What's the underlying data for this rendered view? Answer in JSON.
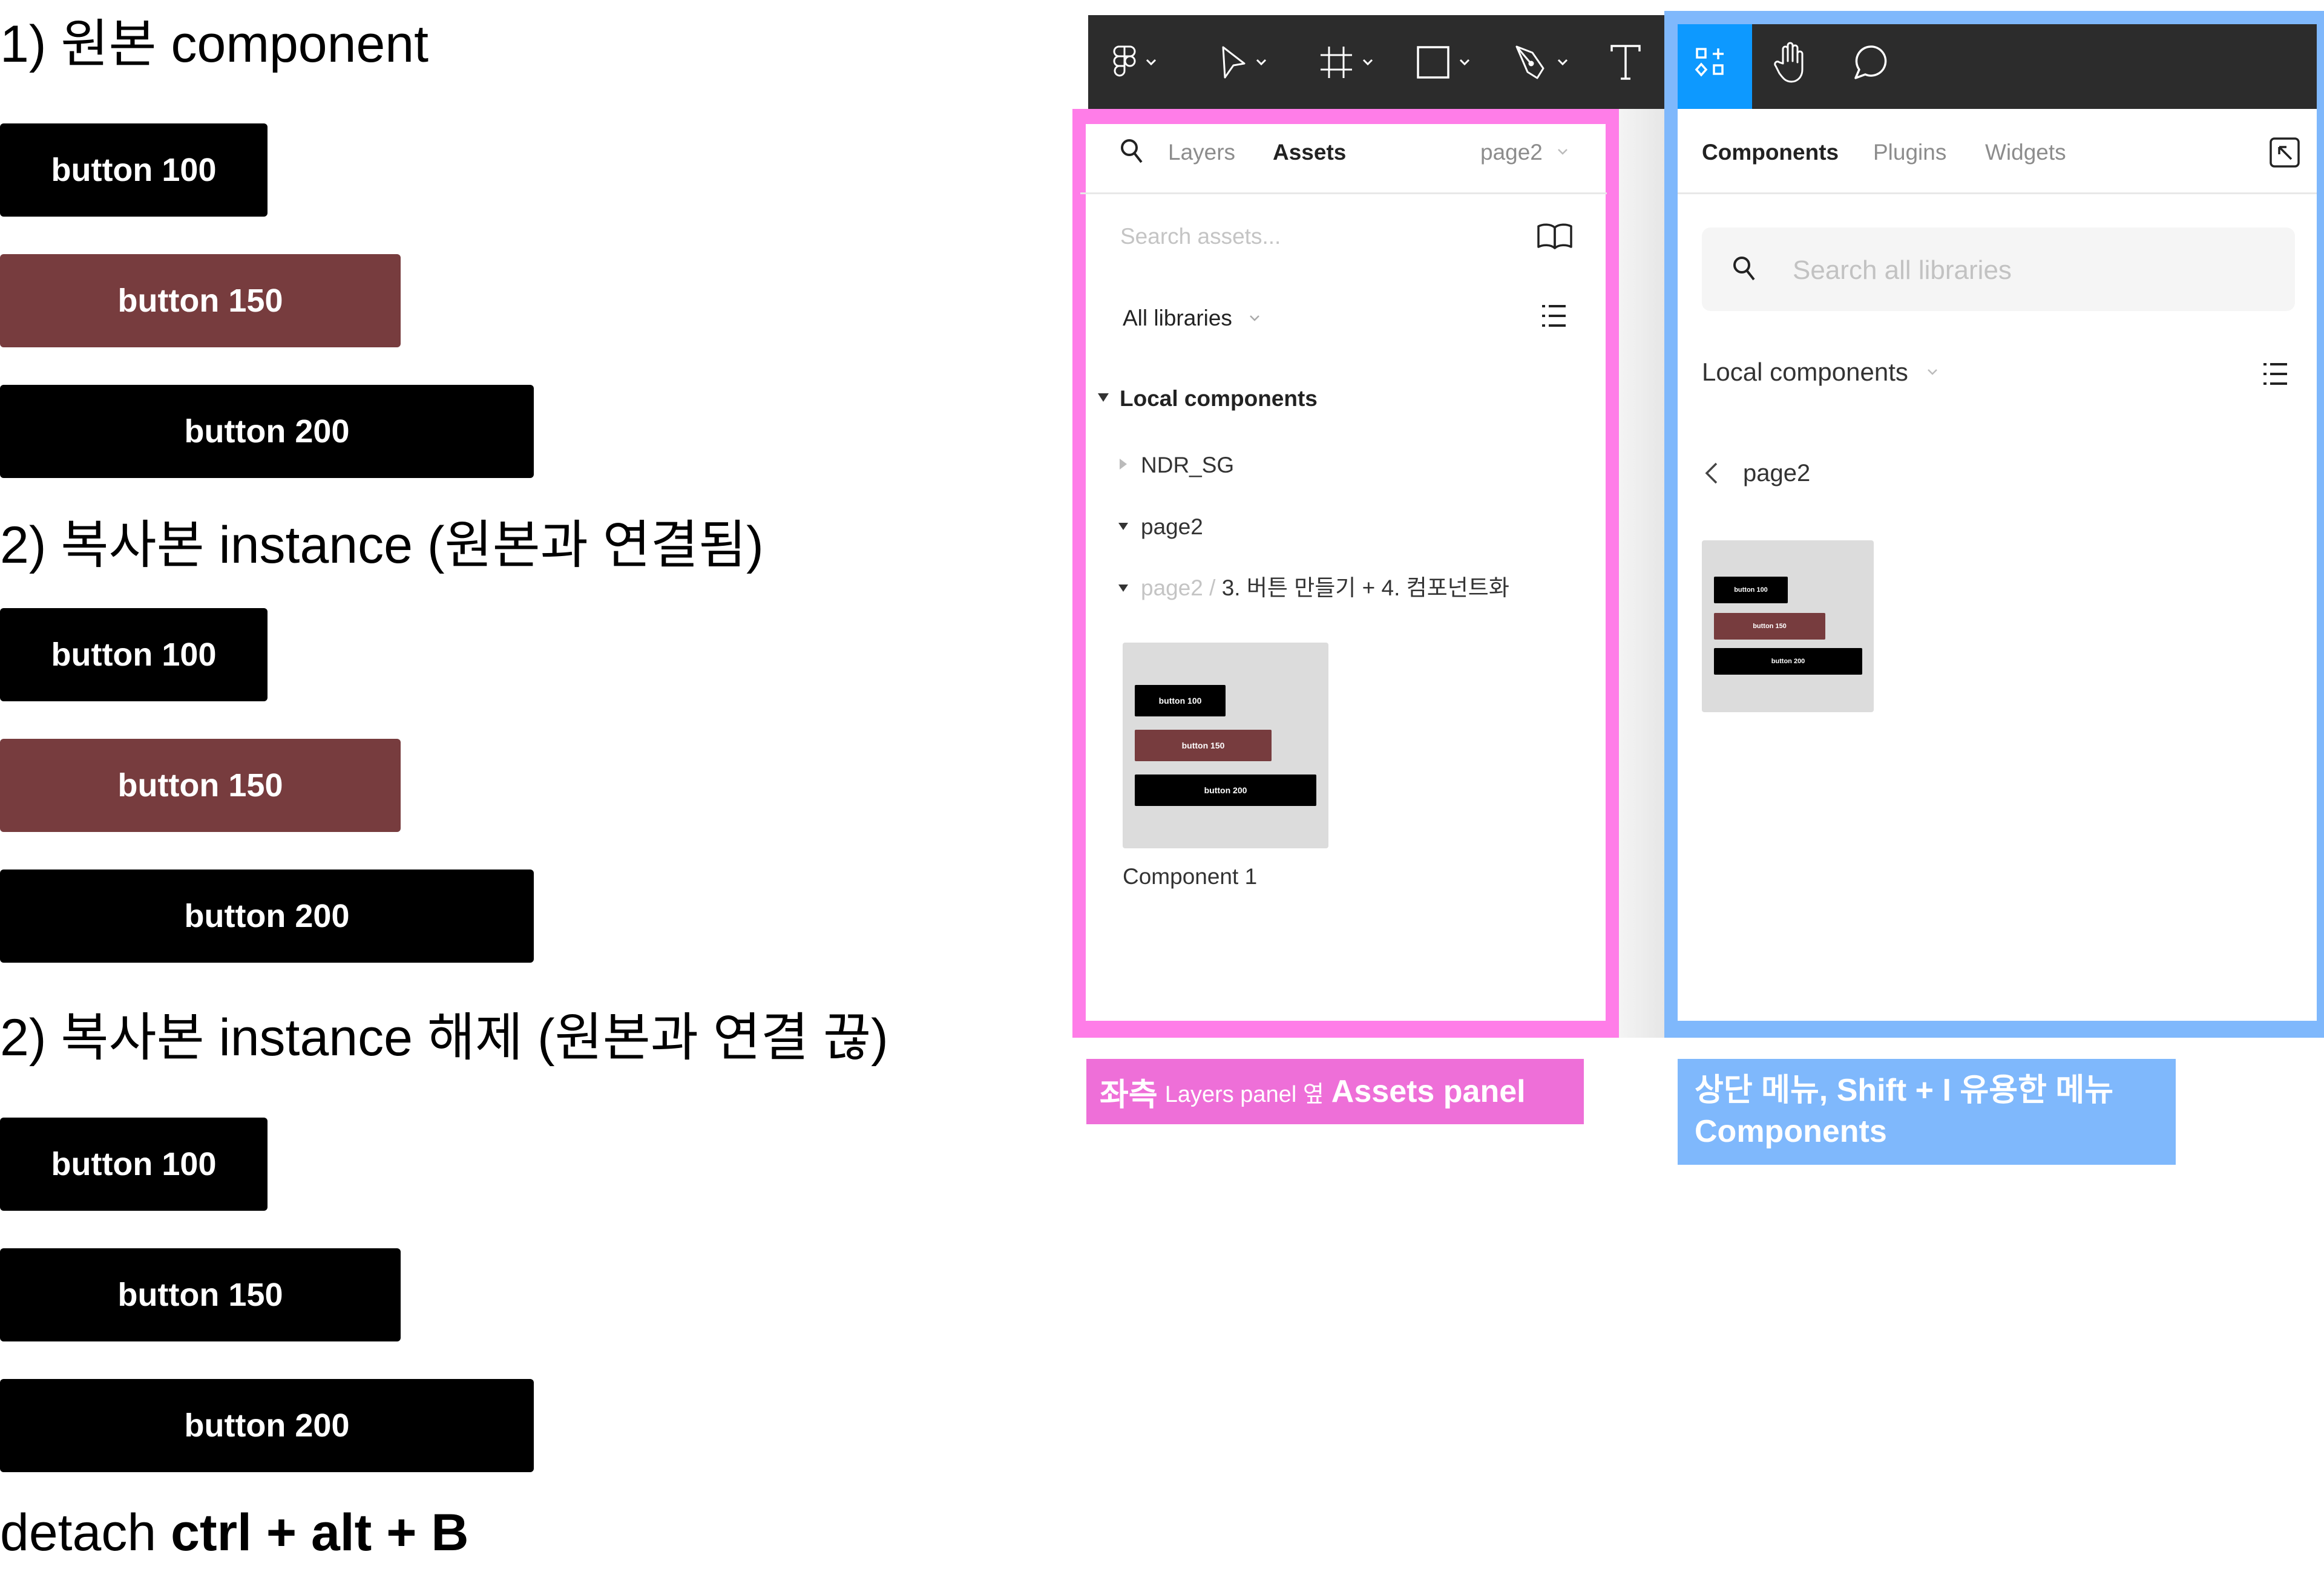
{
  "notes": {
    "section1_title": "1) 원본 component",
    "section2_title": "2) 복사본 instance (원본과 연결됨)",
    "section3_title": "2) 복사본 instance 해제 (원본과 연결 끊)",
    "footer_prefix": "detach ",
    "footer_shortcut": "ctrl + alt + B",
    "groups": [
      {
        "buttons": [
          {
            "label": "button 100",
            "color": "#000000"
          },
          {
            "label": "button 150",
            "color": "#773c3e"
          },
          {
            "label": "button 200",
            "color": "#000000"
          }
        ]
      },
      {
        "buttons": [
          {
            "label": "button 100",
            "color": "#000000"
          },
          {
            "label": "button 150",
            "color": "#773c3e"
          },
          {
            "label": "button 200",
            "color": "#000000"
          }
        ]
      },
      {
        "buttons": [
          {
            "label": "button 100",
            "color": "#000000"
          },
          {
            "label": "button 150",
            "color": "#000000"
          },
          {
            "label": "button 200",
            "color": "#000000"
          }
        ]
      }
    ]
  },
  "toolbar": {
    "tools": [
      {
        "name": "main-menu",
        "icon": "figma-logo-icon",
        "has_dropdown": true
      },
      {
        "name": "move",
        "icon": "cursor-arrow-icon",
        "has_dropdown": true
      },
      {
        "name": "frame",
        "icon": "frame-hash-icon",
        "has_dropdown": true
      },
      {
        "name": "shape",
        "icon": "rectangle-icon",
        "has_dropdown": true
      },
      {
        "name": "pen",
        "icon": "pen-nib-icon",
        "has_dropdown": true
      },
      {
        "name": "text",
        "icon": "text-t-icon",
        "has_dropdown": false
      },
      {
        "name": "resources",
        "icon": "resources-grid-icon",
        "has_dropdown": false,
        "active": true
      },
      {
        "name": "hand",
        "icon": "hand-icon",
        "has_dropdown": false
      },
      {
        "name": "comment",
        "icon": "comment-bubble-icon",
        "has_dropdown": false
      }
    ],
    "active_color": "#0d99ff",
    "background": "#2c2c2c"
  },
  "assets_panel": {
    "tabs": {
      "layers": "Layers",
      "assets": "Assets"
    },
    "page_selector": "page2",
    "search_placeholder": "Search assets...",
    "library_filter": "All libraries",
    "section_title": "Local components",
    "tree": [
      {
        "label": "NDR_SG",
        "expanded": false
      },
      {
        "label": "page2",
        "expanded": true
      },
      {
        "path_prefix": "page2 / ",
        "label": "3. 버튼 만들기 + 4. 컴포넌트화",
        "expanded": true
      }
    ],
    "component_name": "Component 1",
    "thumb_buttons": [
      "button 100",
      "button 150",
      "button 200"
    ]
  },
  "resources_panel": {
    "tabs": {
      "components": "Components",
      "plugins": "Plugins",
      "widgets": "Widgets"
    },
    "search_placeholder": "Search all libraries",
    "library_filter": "Local components",
    "back_label": "page2",
    "thumb_buttons": [
      "button 100",
      "button 150",
      "button 200"
    ]
  },
  "annotations": {
    "pink": {
      "part1": "좌측",
      "part2": "Layers panel 옆",
      "part3": "Assets panel",
      "color": "#ee6fd8"
    },
    "blue": {
      "line1": "상단 메뉴, Shift + I 유용한 메뉴",
      "line2": "Components",
      "color": "#7fb8fc"
    }
  }
}
